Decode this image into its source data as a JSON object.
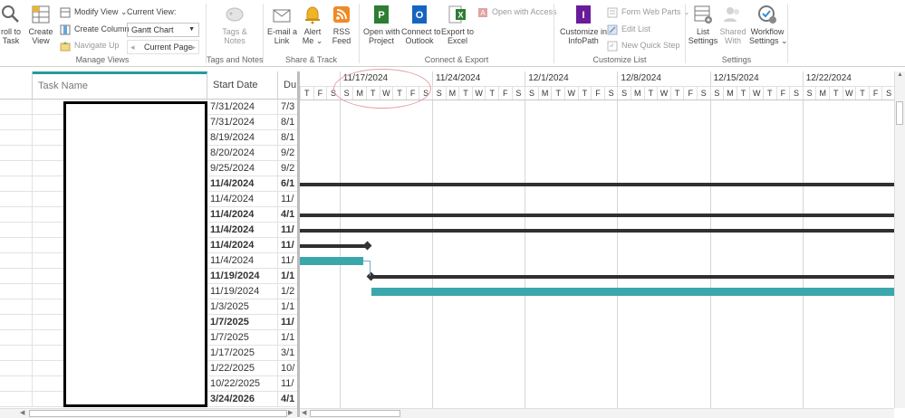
{
  "ribbon": {
    "scroll_to_task": "roll to\nTask",
    "create_view": "Create\nView",
    "modify_view": "Modify View",
    "create_column": "Create Column",
    "navigate_up": "Navigate Up",
    "current_view_label": "Current View:",
    "current_view_value": "Gantt Chart",
    "current_page": "Current Page",
    "group_manage_views": "Manage Views",
    "tags_notes": "Tags &\nNotes",
    "group_tags_notes": "Tags and Notes",
    "email_link": "E-mail a\nLink",
    "alert_me": "Alert\nMe",
    "rss_feed": "RSS\nFeed",
    "group_share_track": "Share & Track",
    "open_with_project": "Open with\nProject",
    "connect_outlook": "Connect to\nOutlook",
    "export_excel": "Export to\nExcel",
    "open_with_access": "Open with Access",
    "group_connect_export": "Connect & Export",
    "customize_infopath": "Customize in\nInfoPath",
    "form_web_parts": "Form Web Parts",
    "edit_list": "Edit List",
    "new_quick_step": "New Quick Step",
    "group_customize_list": "Customize List",
    "list_settings": "List\nSettings",
    "shared_with": "Shared\nWith",
    "workflow_settings": "Workflow\nSettings",
    "group_settings": "Settings"
  },
  "grid": {
    "col_task_name": "Task Name",
    "col_start_date": "Start Date",
    "col_duration": "Du",
    "rows": [
      {
        "start": "7/31/2024",
        "due": "7/3",
        "bold": false
      },
      {
        "start": "7/31/2024",
        "due": "8/1",
        "bold": false
      },
      {
        "start": "8/19/2024",
        "due": "8/1",
        "bold": false
      },
      {
        "start": "8/20/2024",
        "due": "9/2",
        "bold": false
      },
      {
        "start": "9/25/2024",
        "due": "9/2",
        "bold": false
      },
      {
        "start": "11/4/2024",
        "due": "6/1",
        "bold": true
      },
      {
        "start": "11/4/2024",
        "due": "11/",
        "bold": false
      },
      {
        "start": "11/4/2024",
        "due": "4/1",
        "bold": true
      },
      {
        "start": "11/4/2024",
        "due": "11/",
        "bold": true
      },
      {
        "start": "11/4/2024",
        "due": "11/",
        "bold": true
      },
      {
        "start": "11/4/2024",
        "due": "11/",
        "bold": false
      },
      {
        "start": "11/19/2024",
        "due": "1/1",
        "bold": true
      },
      {
        "start": "11/19/2024",
        "due": "1/2",
        "bold": false
      },
      {
        "start": "1/3/2025",
        "due": "1/1",
        "bold": false
      },
      {
        "start": "1/7/2025",
        "due": "11/",
        "bold": true
      },
      {
        "start": "1/7/2025",
        "due": "1/1",
        "bold": false
      },
      {
        "start": "1/17/2025",
        "due": "3/1",
        "bold": false
      },
      {
        "start": "1/22/2025",
        "due": "10/",
        "bold": false
      },
      {
        "start": "10/22/2025",
        "due": "11/",
        "bold": false
      },
      {
        "start": "3/24/2026",
        "due": "4/1",
        "bold": true
      }
    ]
  },
  "gantt": {
    "weeks": [
      "11/17/2024",
      "11/24/2024",
      "12/1/2024",
      "12/8/2024",
      "12/15/2024",
      "12/22/2024"
    ],
    "lead_days": [
      "T",
      "F",
      "S"
    ],
    "week_days": [
      "S",
      "M",
      "T",
      "W",
      "T",
      "F",
      "S"
    ]
  },
  "colors": {
    "accent": "#2a9a9a",
    "task_bar": "#3ba7ac",
    "summary_bar": "#303030",
    "annotation": "#e8a0a8"
  }
}
